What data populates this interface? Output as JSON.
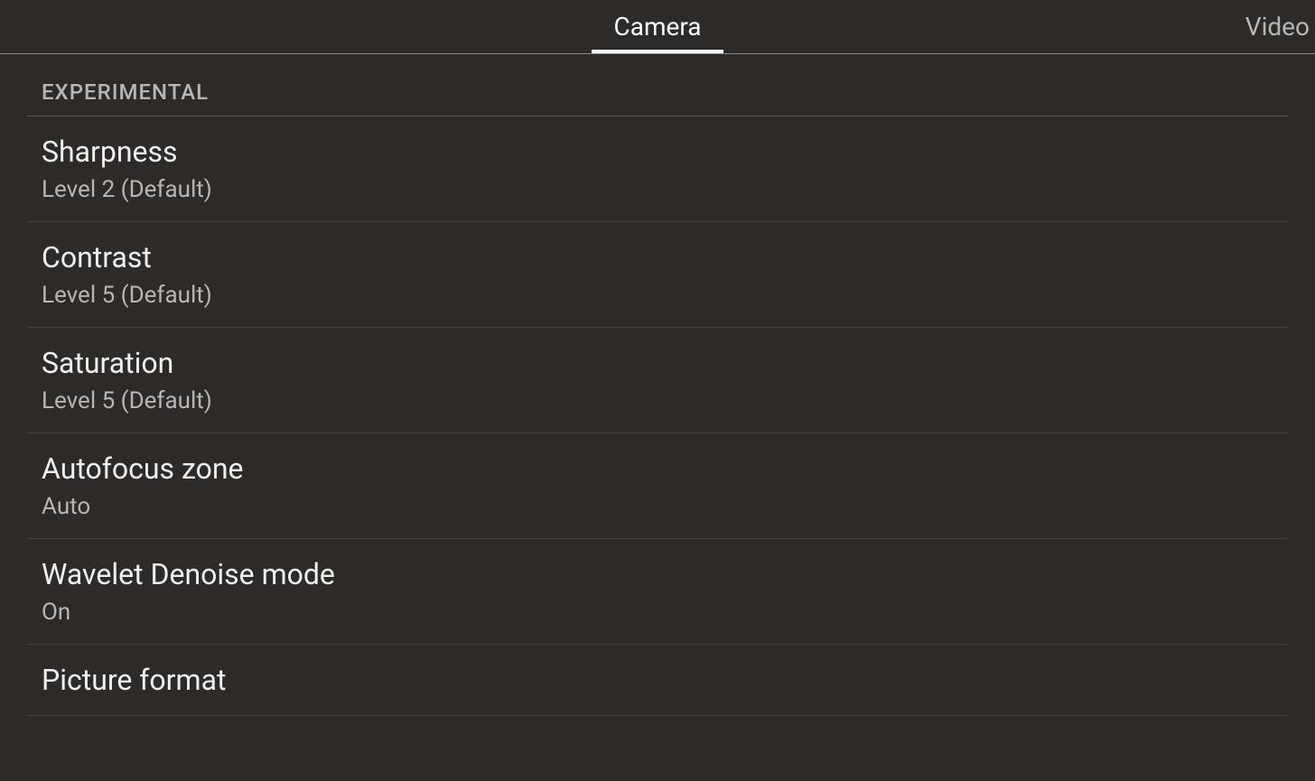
{
  "tabs": {
    "camera": "Camera",
    "video": "Video"
  },
  "section": {
    "header": "EXPERIMENTAL"
  },
  "settings": [
    {
      "title": "Sharpness",
      "value": "Level 2 (Default)"
    },
    {
      "title": "Contrast",
      "value": "Level 5 (Default)"
    },
    {
      "title": "Saturation",
      "value": "Level 5 (Default)"
    },
    {
      "title": "Autofocus zone",
      "value": "Auto"
    },
    {
      "title": "Wavelet Denoise mode",
      "value": "On"
    },
    {
      "title": "Picture format",
      "value": ""
    }
  ]
}
